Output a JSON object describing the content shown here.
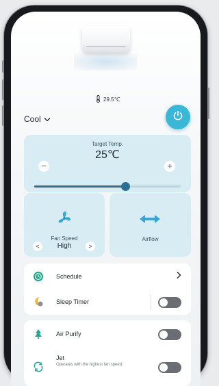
{
  "header": {
    "current_temp": "29.5℃",
    "mode": "Cool"
  },
  "target": {
    "label": "Target Temp.",
    "value": "25℃",
    "slider_level_percent": 62
  },
  "fan": {
    "label": "Fan Speed",
    "value": "High"
  },
  "airflow": {
    "label": "Airflow"
  },
  "rows": {
    "schedule": "Schedule",
    "sleep_timer": "Sleep Timer",
    "air_purify": "Air Purify",
    "jet": "Jet",
    "jet_desc": "Operates with the highest fan speed."
  },
  "toggles": {
    "sleep_timer": false,
    "air_purify": false,
    "jet": false
  },
  "colors": {
    "accent": "#3ab6d6",
    "card": "#d7ecf3",
    "slider": "#2d6e91",
    "toggle_off": "#6a6d73"
  }
}
